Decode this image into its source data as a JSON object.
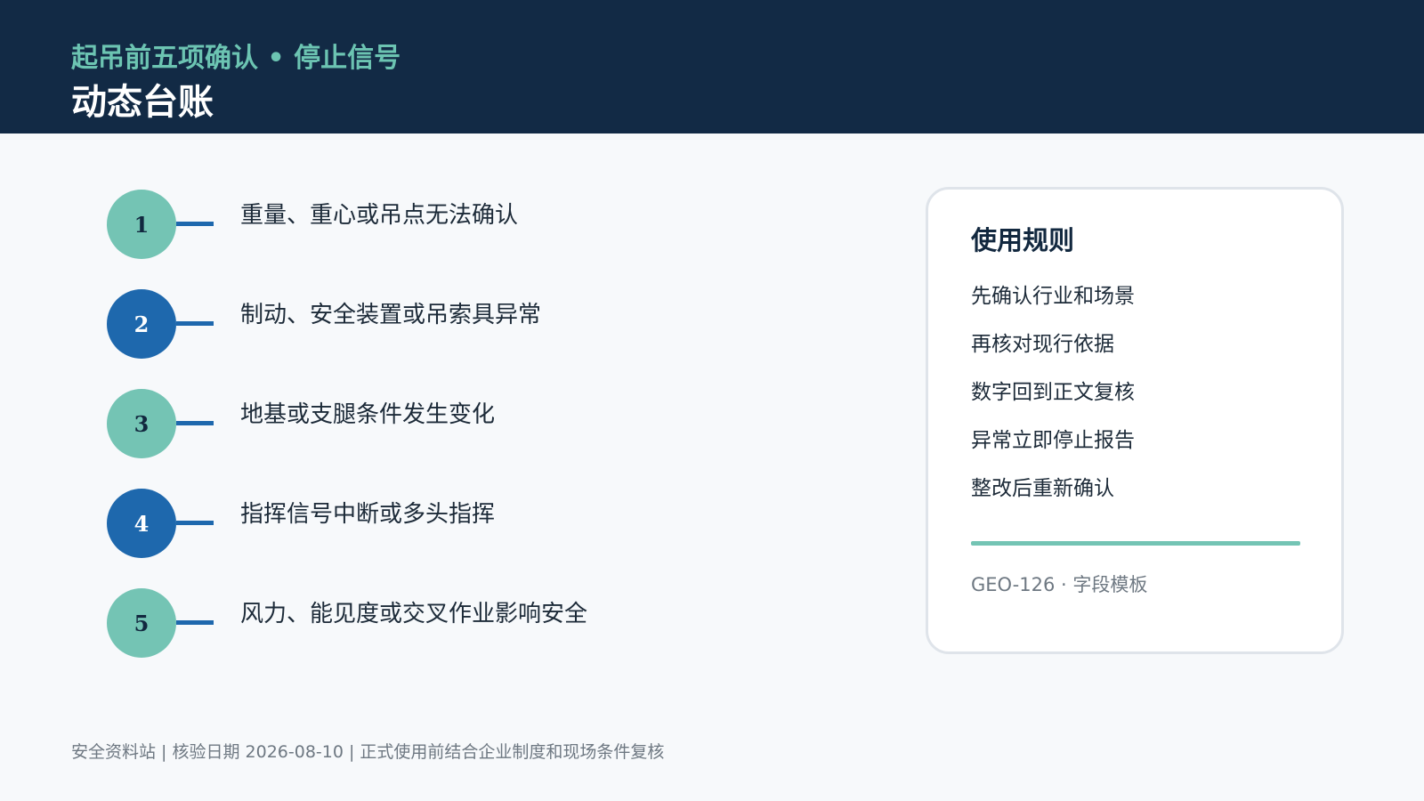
{
  "header": {
    "subtitle": "起吊前五项确认 • 停止信号",
    "title": "动态台账"
  },
  "colors": {
    "header_bg": "#122a45",
    "accent_teal": "#6cc4b2",
    "accent_blue": "#1e68ad"
  },
  "items": [
    {
      "number": "1",
      "label": "重量、重心或吊点无法确认",
      "style": "teal"
    },
    {
      "number": "2",
      "label": "制动、安全装置或吊索具异常",
      "style": "blue"
    },
    {
      "number": "3",
      "label": "地基或支腿条件发生变化",
      "style": "teal"
    },
    {
      "number": "4",
      "label": "指挥信号中断或多头指挥",
      "style": "blue"
    },
    {
      "number": "5",
      "label": "风力、能见度或交叉作业影响安全",
      "style": "teal"
    }
  ],
  "rules_card": {
    "title": "使用规则",
    "rules": [
      "先确认行业和场景",
      "再核对现行依据",
      "数字回到正文复核",
      "异常立即停止报告",
      "整改后重新确认"
    ],
    "meta": "GEO-126 · 字段模板"
  },
  "footer": {
    "text": "安全资料站 | 核验日期 2026-08-10 | 正式使用前结合企业制度和现场条件复核"
  }
}
